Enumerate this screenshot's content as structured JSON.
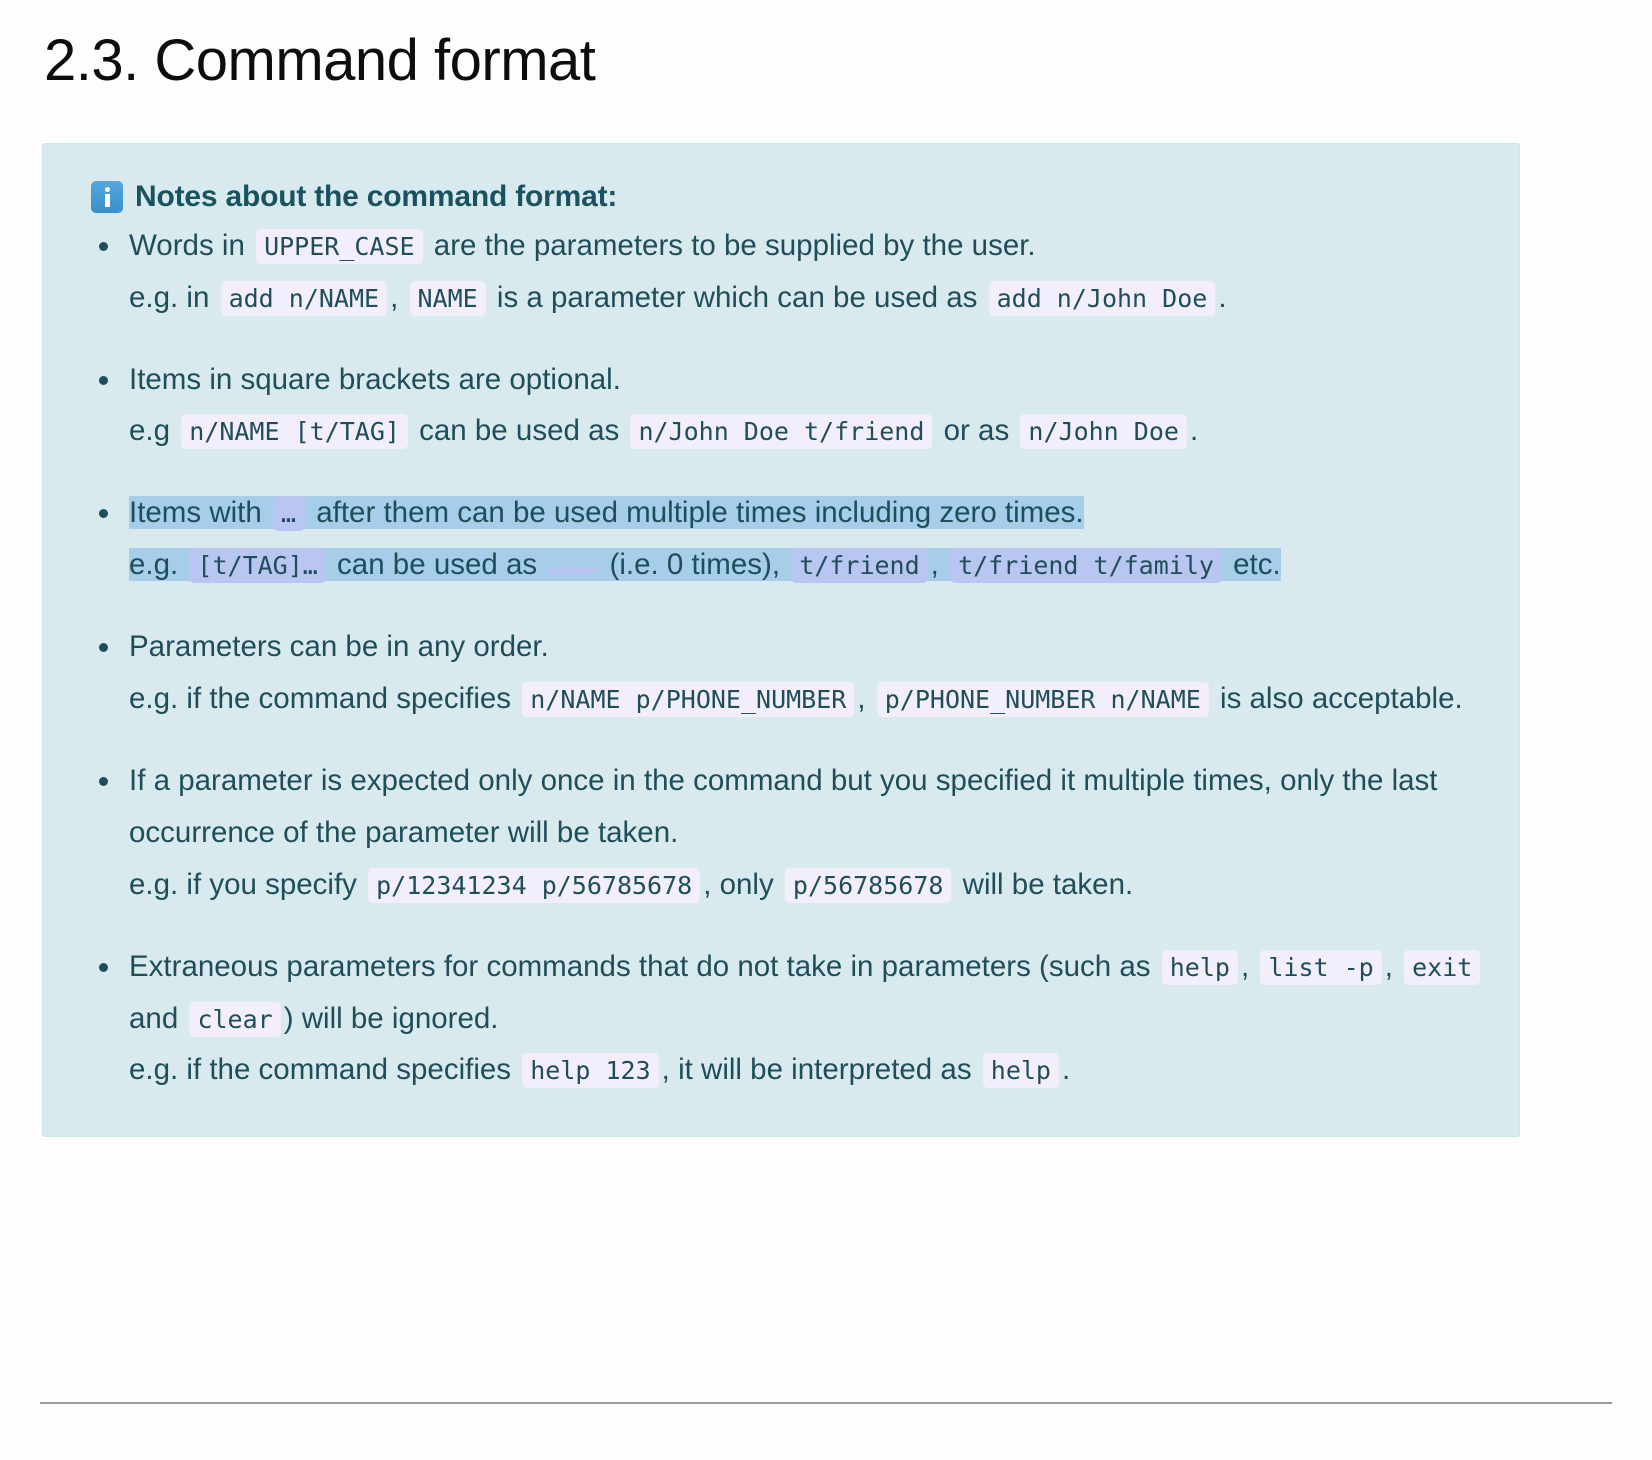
{
  "page": {
    "title": "2.3. Command format"
  },
  "callout": {
    "icon_name": "info-icon",
    "header": "Notes about the command format:",
    "notes": [
      {
        "line1": {
          "a": "Words in",
          "code1": "UPPER_CASE",
          "b": "are the parameters to be supplied by the user."
        },
        "line2": {
          "a": "e.g. in",
          "code1": "add n/NAME",
          "b": ",",
          "code2": "NAME",
          "c": "is a parameter which can be used as",
          "code3": "add n/John Doe",
          "d": "."
        }
      },
      {
        "line1": {
          "a": "Items in square brackets are optional."
        },
        "line2": {
          "a": "e.g",
          "code1": "n/NAME [t/TAG]",
          "b": "can be used as",
          "code2": "n/John Doe t/friend",
          "c": "or as",
          "code3": "n/John Doe",
          "d": "."
        }
      },
      {
        "selected": true,
        "line1": {
          "a": "Items with",
          "code1": "…",
          "b": "after them can be used multiple times including zero times."
        },
        "line2": {
          "a": "e.g.",
          "code1": "[t/TAG]…",
          "b": "can be used as",
          "code2": "",
          "c": "(i.e. 0 times),",
          "code3": "t/friend",
          "d": ",",
          "code4": "t/friend t/family",
          "e": "etc."
        }
      },
      {
        "line1": {
          "a": "Parameters can be in any order."
        },
        "line2": {
          "a": "e.g. if the command specifies",
          "code1": "n/NAME p/PHONE_NUMBER",
          "b": ",",
          "code2": "p/PHONE_NUMBER n/NAME",
          "c": "is also acceptable."
        }
      },
      {
        "line1": {
          "a": "If a parameter is expected only once in the command but you specified it multiple times, only the last occurrence of the parameter will be taken."
        },
        "line2": {
          "a": "e.g. if you specify",
          "code1": "p/12341234 p/56785678",
          "b": ", only",
          "code2": "p/56785678",
          "c": "will be taken."
        }
      },
      {
        "line1": {
          "a": "Extraneous parameters for commands that do not take in parameters (such as",
          "code1": "help",
          "b": ",",
          "code2": "list -p",
          "c": ",",
          "code3": "exit",
          "d": "and",
          "code4": "clear",
          "e": ") will be ignored."
        },
        "line2": {
          "a": "e.g. if the command specifies",
          "code1": "help 123",
          "b": ", it will be interpreted as",
          "code2": "help",
          "c": "."
        }
      }
    ]
  },
  "colors": {
    "callout_bg": "#d8eaee",
    "text": "#1f4e5a",
    "code_bg": "#f3eefb",
    "selection_bg": "#a6cde9",
    "selection_code_bg": "#b9c6f2",
    "icon_blue": "#3b8fc9",
    "rule": "#9b9b9b"
  }
}
